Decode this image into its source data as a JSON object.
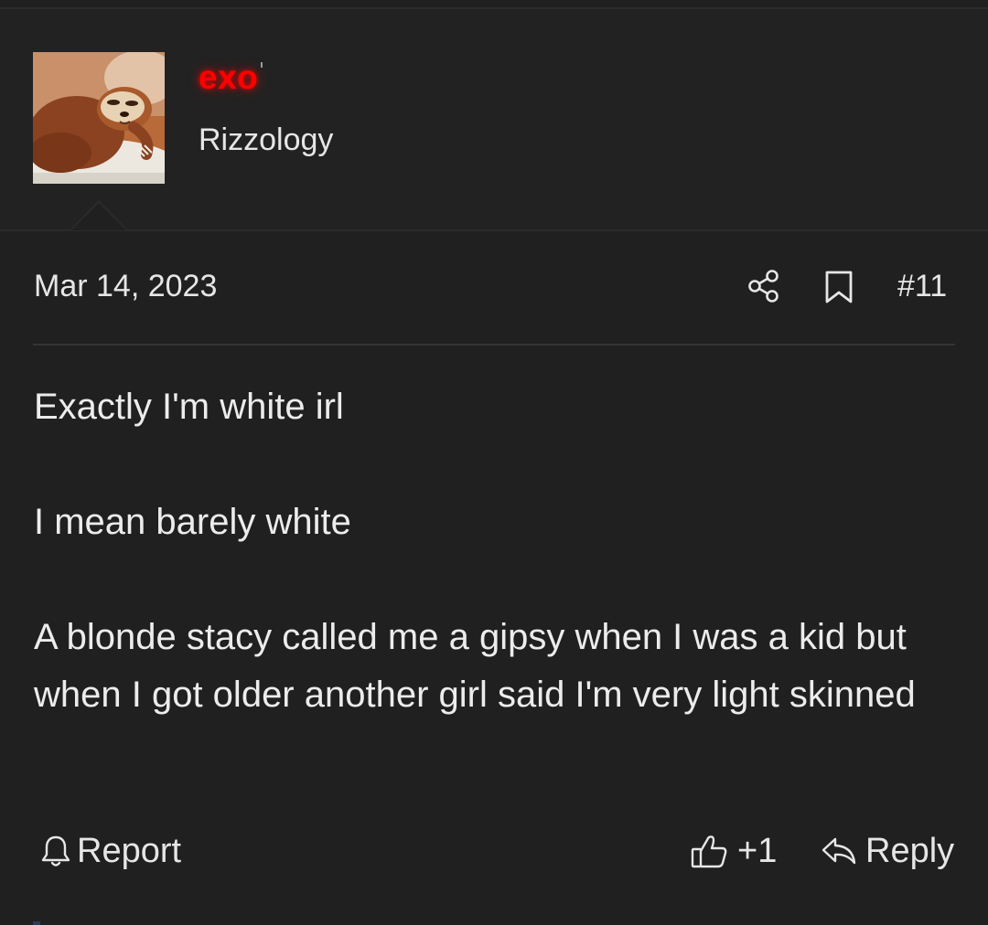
{
  "user": {
    "name": "exo",
    "title": "Rizzology",
    "name_color": "#ff0000",
    "avatar_icon": "sloth-avatar"
  },
  "post": {
    "date": "Mar 14, 2023",
    "number": "#11",
    "paragraphs": [
      "Exactly I'm white irl",
      "I mean barely white",
      "A blonde stacy called me a gipsy when I was a kid but when I got older another girl said I'm very light skinned"
    ]
  },
  "actions": {
    "share_icon": "share-icon",
    "bookmark_icon": "bookmark-icon",
    "report_label": "Report",
    "report_icon": "bell-icon",
    "reaction_count": "+1",
    "reaction_icon": "thumbs-up-icon",
    "reply_label": "Reply",
    "reply_icon": "reply-arrow-icon"
  },
  "colors": {
    "background": "#202020",
    "text": "#e6e6e6",
    "username": "#ff0000"
  }
}
